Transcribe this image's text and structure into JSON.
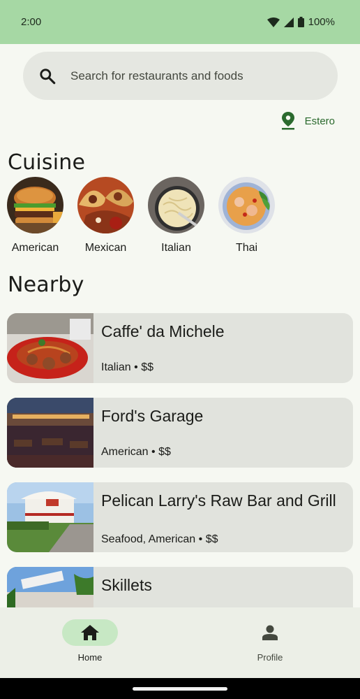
{
  "status_bar": {
    "time": "2:00",
    "battery": "100%"
  },
  "search": {
    "placeholder": "Search for restaurants and foods",
    "value": ""
  },
  "location": {
    "city": "Estero",
    "icon": "location-pin-icon"
  },
  "cuisine": {
    "title": "Cuisine",
    "items": [
      {
        "label": "American",
        "icon": "burger-image"
      },
      {
        "label": "Mexican",
        "icon": "tacos-image"
      },
      {
        "label": "Italian",
        "icon": "pasta-image"
      },
      {
        "label": "Thai",
        "icon": "thai-curry-image"
      }
    ]
  },
  "nearby": {
    "title": "Nearby",
    "restaurants": [
      {
        "name": "Caffe' da Michele",
        "meta": "Italian • $$"
      },
      {
        "name": "Ford's Garage",
        "meta": "American • $$"
      },
      {
        "name": "Pelican Larry's Raw Bar and Grill",
        "meta": "Seafood, American • $$"
      },
      {
        "name": "Skillets",
        "meta": ""
      }
    ]
  },
  "bottom_nav": {
    "items": [
      {
        "label": "Home",
        "icon": "home-icon",
        "active": true
      },
      {
        "label": "Profile",
        "icon": "person-icon",
        "active": false
      }
    ]
  },
  "colors": {
    "status_bar": "#a6d8a4",
    "accent": "#2b6a2e",
    "card_bg": "#e1e3dd",
    "nav_active": "#c7e8c4"
  }
}
